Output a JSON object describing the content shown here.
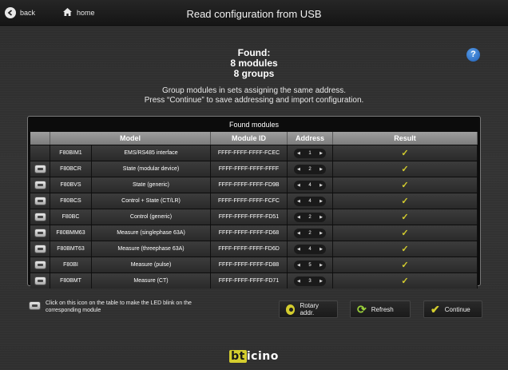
{
  "header": {
    "back_label": "back",
    "home_label": "home",
    "title": "Read configuration from USB"
  },
  "summary": {
    "line1": "Found:",
    "line2": "8 modules",
    "line3": "8 groups",
    "help": "?"
  },
  "instructions": {
    "line1": "Group modules in sets assigning the same address.",
    "line2": "Press “Continue” to save addressing and import configuration."
  },
  "table": {
    "title": "Found modules",
    "columns": [
      "",
      "Model",
      "Module ID",
      "Address",
      "Result"
    ],
    "rows": [
      {
        "has_icon": false,
        "code": "F80BIM1",
        "model": "EMS/RS485 interface",
        "module_id": "FFFF-FFFF-FFFF-FCEC",
        "address": "1",
        "result": "✓"
      },
      {
        "has_icon": true,
        "code": "F80BCR",
        "model": "State (modular device)",
        "module_id": "FFFF-FFFF-FFFF-FFFF",
        "address": "2",
        "result": "✓"
      },
      {
        "has_icon": true,
        "code": "F80BVS",
        "model": "State (generic)",
        "module_id": "FFFF-FFFF-FFFF-FD9B",
        "address": "4",
        "result": "✓"
      },
      {
        "has_icon": true,
        "code": "F80BCS",
        "model": "Control + State (CT/LR)",
        "module_id": "FFFF-FFFF-FFFF-FCFC",
        "address": "4",
        "result": "✓"
      },
      {
        "has_icon": true,
        "code": "F80BC",
        "model": "Control (generic)",
        "module_id": "FFFF-FFFF-FFFF-FD51",
        "address": "2",
        "result": "✓"
      },
      {
        "has_icon": true,
        "code": "F80BMM63",
        "model": "Measure (singlephase 63A)",
        "module_id": "FFFF-FFFF-FFFF-FD68",
        "address": "2",
        "result": "✓"
      },
      {
        "has_icon": true,
        "code": "F80BMT63",
        "model": "Measure (threephase 63A)",
        "module_id": "FFFF-FFFF-FFFF-FD6D",
        "address": "4",
        "result": "✓"
      },
      {
        "has_icon": true,
        "code": "F80BI",
        "model": "Measure (pulse)",
        "module_id": "FFFF-FFFF-FFFF-FD88",
        "address": "5",
        "result": "✓"
      },
      {
        "has_icon": true,
        "code": "F80BMT",
        "model": "Measure (CT)",
        "module_id": "FFFF-FFFF-FFFF-FD71",
        "address": "3",
        "result": "✓"
      }
    ]
  },
  "legend": {
    "text": "Click on this icon on the table to make the LED blink on the corresponding module"
  },
  "buttons": {
    "rotary": "Rotary addr.",
    "refresh": "Refresh",
    "continue": "Continue"
  },
  "brand": {
    "logo_text": "bticino"
  },
  "colors": {
    "accent_check": "#d4cd2e",
    "help_blue": "#2a6fd0",
    "refresh_green": "#9bd23b"
  },
  "icons": {
    "back": "back-arrow-icon",
    "home": "home-icon",
    "help": "help-icon",
    "led": "led-blink-icon",
    "rotary": "rotary-icon",
    "refresh": "refresh-icon",
    "continue": "checkmark-icon"
  }
}
